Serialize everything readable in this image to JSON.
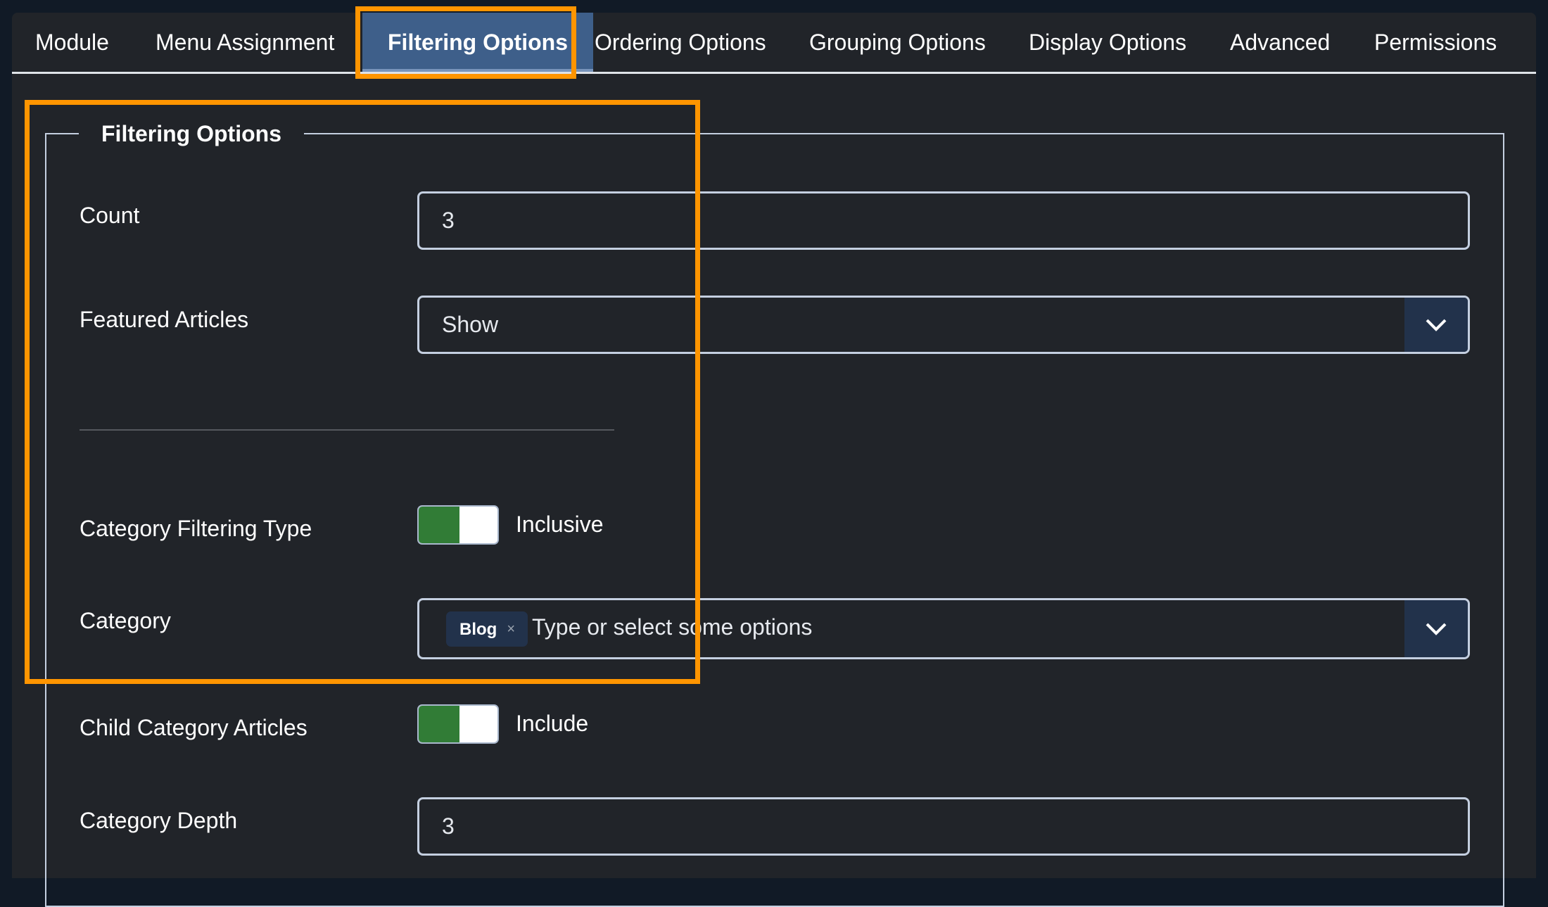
{
  "tabs": [
    {
      "label": "Module",
      "active": false
    },
    {
      "label": "Menu Assignment",
      "active": false
    },
    {
      "label": "Filtering Options",
      "active": true
    },
    {
      "label": "Ordering Options",
      "active": false
    },
    {
      "label": "Grouping Options",
      "active": false
    },
    {
      "label": "Display Options",
      "active": false
    },
    {
      "label": "Advanced",
      "active": false
    },
    {
      "label": "Permissions",
      "active": false
    }
  ],
  "fieldset": {
    "legend": "Filtering Options",
    "fields": {
      "count": {
        "label": "Count",
        "value": "3"
      },
      "featured": {
        "label": "Featured Articles",
        "value": "Show",
        "icon": "chevron-down-icon"
      },
      "category_filtering_type": {
        "label": "Category Filtering Type",
        "state_label": "Inclusive",
        "on": true
      },
      "category": {
        "label": "Category",
        "chips": [
          {
            "label": "Blog",
            "remove": "×"
          }
        ],
        "placeholder": "Type or select some options",
        "icon": "chevron-down-icon"
      },
      "child_category_articles": {
        "label": "Child Category Articles",
        "state_label": "Include",
        "on": true
      },
      "category_depth": {
        "label": "Category Depth",
        "value": "3"
      }
    }
  },
  "colors": {
    "highlight": "#ff9500",
    "active_tab": "#3e5f8a",
    "toggle_on": "#317c36",
    "background": "#212429"
  }
}
